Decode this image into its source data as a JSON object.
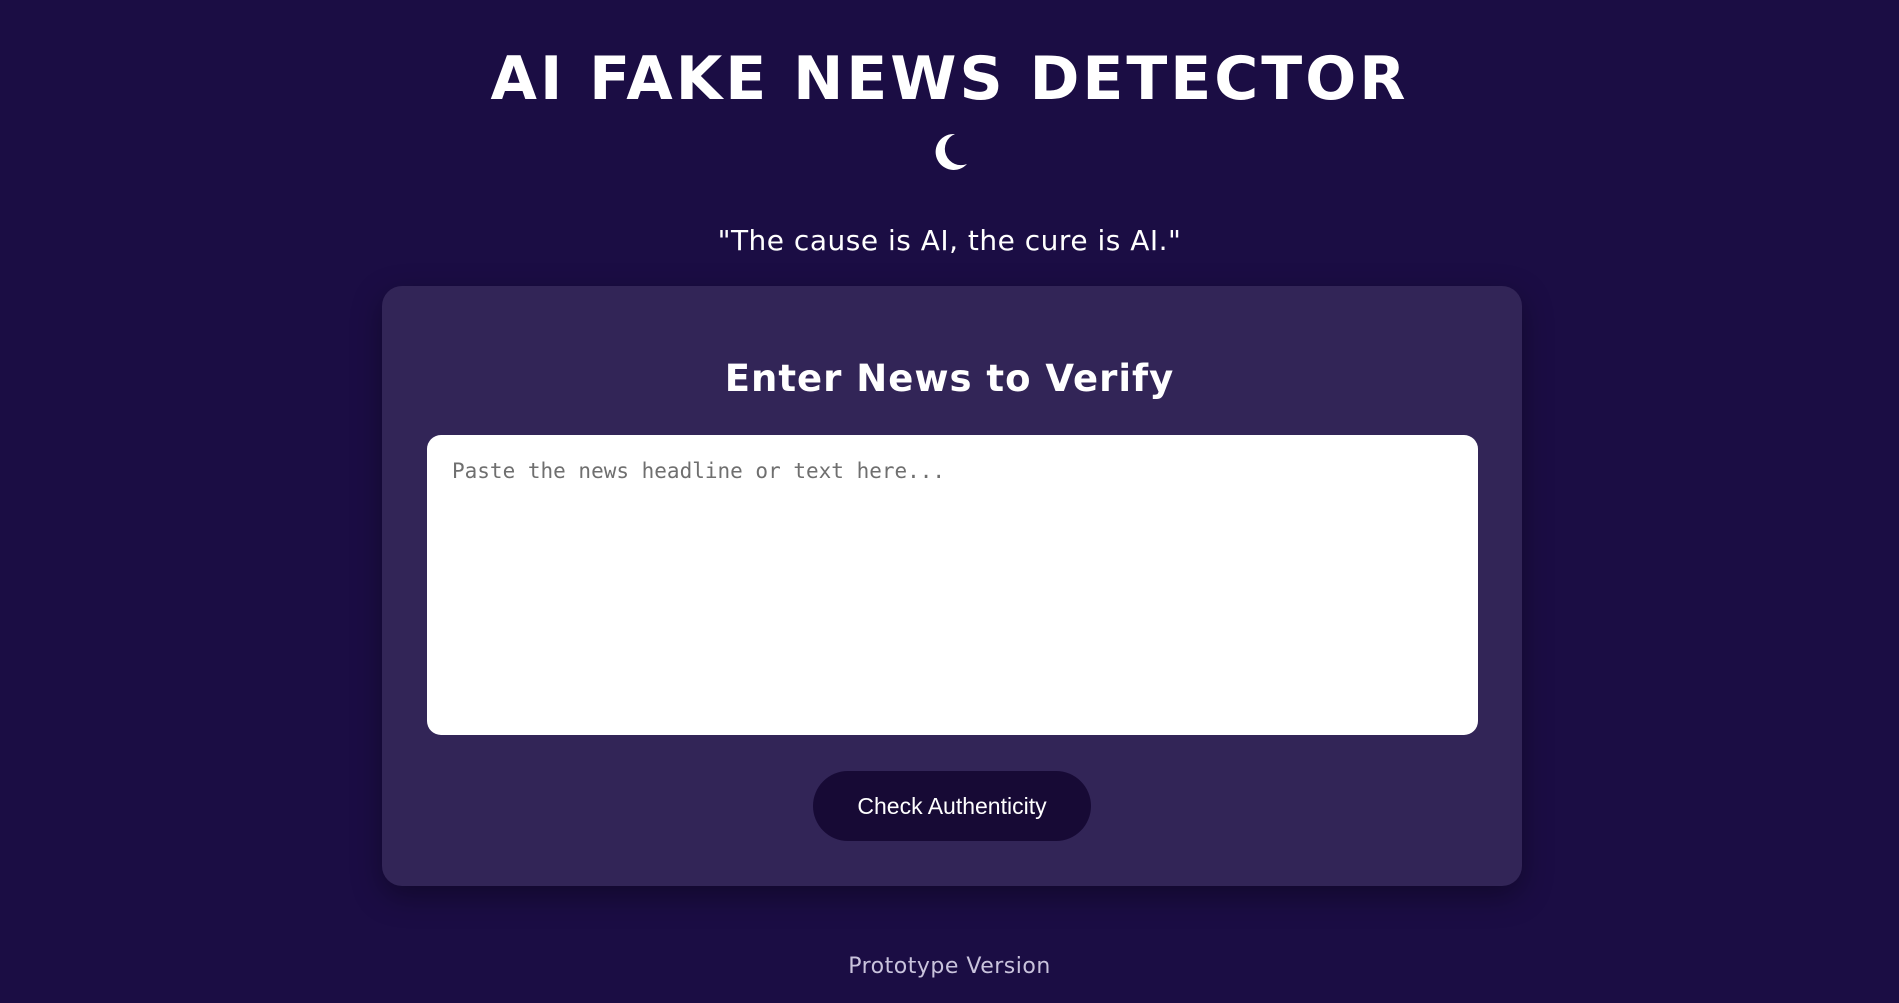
{
  "header": {
    "title": "AI FAKE NEWS DETECTOR",
    "theme_icon": "moon-icon",
    "tagline": "\"The cause is AI, the cure is AI.\""
  },
  "card": {
    "heading": "Enter News to Verify",
    "input": {
      "value": "",
      "placeholder": "Paste the news headline or text here..."
    },
    "button_label": "Check Authenticity"
  },
  "footer": {
    "text": "Prototype Version"
  },
  "colors": {
    "background": "#1b0d44",
    "card": "#322557",
    "button": "#170a35",
    "text": "#ffffff",
    "footer_text": "#c9c3dc"
  }
}
